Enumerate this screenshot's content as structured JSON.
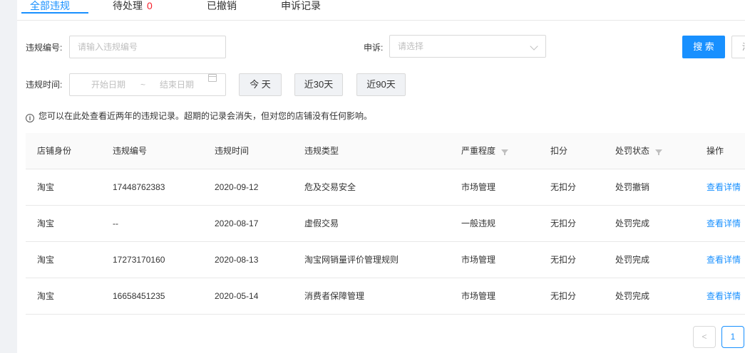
{
  "tabs": [
    {
      "label": "全部违规",
      "active": true
    },
    {
      "label": "待处理",
      "count": "0"
    },
    {
      "label": "已撤销"
    },
    {
      "label": "申诉记录"
    }
  ],
  "filters": {
    "violation_no_label": "违规编号:",
    "violation_no_placeholder": "请输入违规编号",
    "appeal_label": "申诉:",
    "appeal_placeholder": "请选择",
    "search_label": "搜 索",
    "cut_button_label": "清",
    "time_label": "违规时间:",
    "start_placeholder": "开始日期",
    "range_sep": "~",
    "end_placeholder": "结束日期",
    "quick": [
      "今 天",
      "近30天",
      "近90天"
    ]
  },
  "notice": {
    "icon": "info-icon",
    "text": "您可以在此处查看近两年的违规记录。超期的记录会消失，但对您的店铺没有任何影响。"
  },
  "table": {
    "columns": [
      "店铺身份",
      "违规编号",
      "违规时间",
      "违规类型",
      "严重程度",
      "扣分",
      "处罚状态",
      "操作"
    ],
    "rows": [
      [
        "淘宝",
        "17448762383",
        "2020-09-12",
        "危及交易安全",
        "市场管理",
        "无扣分",
        "处罚撤销",
        "查看详情"
      ],
      [
        "淘宝",
        "--",
        "2020-08-17",
        "虚假交易",
        "一般违规",
        "无扣分",
        "处罚完成",
        "查看详情"
      ],
      [
        "淘宝",
        "17273170160",
        "2020-08-13",
        "淘宝网销量评价管理规则",
        "市场管理",
        "无扣分",
        "处罚完成",
        "查看详情"
      ],
      [
        "淘宝",
        "16658451235",
        "2020-05-14",
        "消费者保障管理",
        "市场管理",
        "无扣分",
        "处罚完成",
        "查看详情"
      ]
    ]
  },
  "pagination": {
    "prev": "<",
    "current": "1"
  },
  "colors": {
    "accent": "#1890ff",
    "badge": "#f5222d"
  }
}
